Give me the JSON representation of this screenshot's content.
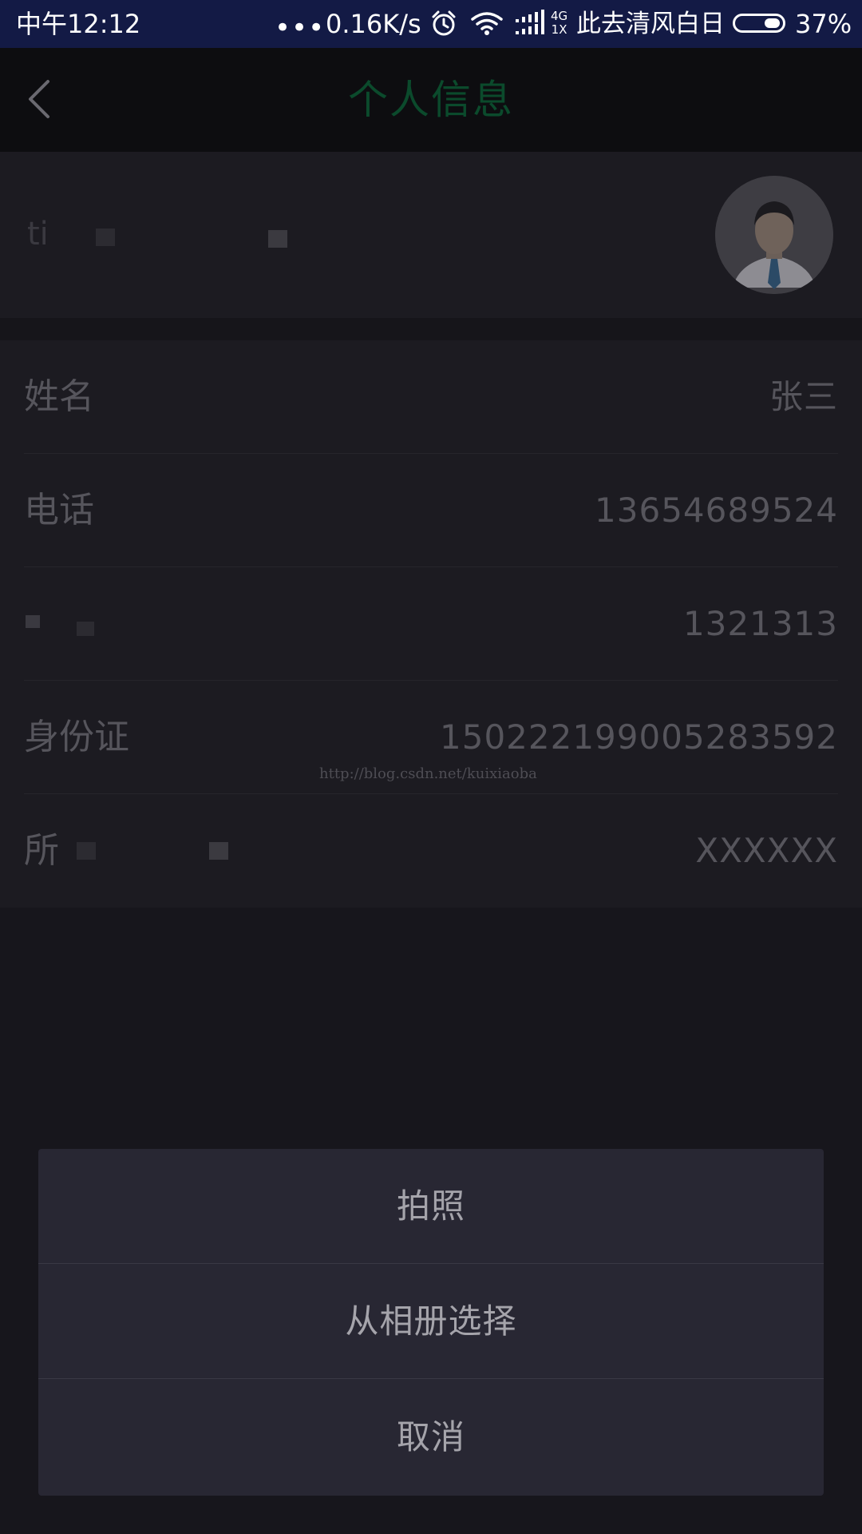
{
  "status_bar": {
    "time": "中午12:12",
    "dots": "•••",
    "net_speed": "0.16K/s",
    "network_type_top": "4G",
    "network_type_bottom": "1X",
    "carrier": "此去清风白日",
    "battery_percent": "37%",
    "battery_level": 0.37,
    "icons": [
      "alarm-icon",
      "wifi-icon",
      "signal-icon",
      "battery-icon"
    ]
  },
  "app_bar": {
    "title": "个人信息",
    "title_color": "#0b4a2c",
    "back_icon": "chevron-left-icon"
  },
  "avatar_row": {
    "label": "ti"
  },
  "info_rows": [
    {
      "label": "姓名",
      "value": "张三"
    },
    {
      "label": "电话",
      "value": "13654689524"
    },
    {
      "label": "",
      "value": "1321313"
    },
    {
      "label": "身份证",
      "value": "150222199005283592"
    },
    {
      "label": "所",
      "value": "XXXXXX"
    }
  ],
  "watermark": "http://blog.csdn.net/kuixiaoba",
  "action_sheet": {
    "options": [
      {
        "label": "拍照"
      },
      {
        "label": "从相册选择"
      },
      {
        "label": "取消"
      }
    ]
  }
}
